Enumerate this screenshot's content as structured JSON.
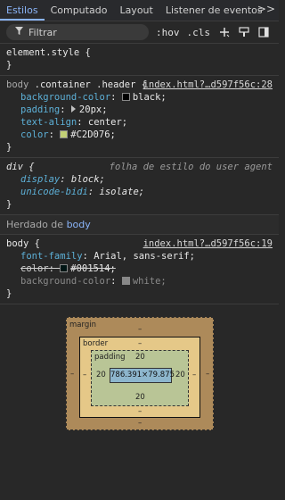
{
  "tabs": [
    "Estilos",
    "Computado",
    "Layout",
    "Listener de eventos"
  ],
  "more_icon": ">>",
  "toolbar": {
    "filter_placeholder": "Filtrar",
    "hov": ":hov",
    "cls": ".cls",
    "add_icon": "+",
    "icon_paint": "paint-icon",
    "icon_sidebar": "sidebar-toggle-icon"
  },
  "element_style": {
    "selector": "element.style {",
    "close": "}"
  },
  "rule1": {
    "selector_prefix": "body",
    "selector_main": " .container .header {",
    "source": "index.html?…d597f56c:28",
    "decls": [
      {
        "name": "background-color",
        "value": "black;",
        "swatch": "#000000"
      },
      {
        "name": "padding",
        "value": "20px;",
        "expand": true
      },
      {
        "name": "text-align",
        "value": "center;"
      },
      {
        "name": "color",
        "value": "#C2D076;",
        "swatch": "#C2D076"
      }
    ],
    "close": "}"
  },
  "rule2": {
    "selector": "div {",
    "source": "folha de estilo do user agent",
    "decls": [
      {
        "name": "display",
        "value": "block;"
      },
      {
        "name": "unicode-bidi",
        "value": "isolate;"
      }
    ],
    "close": "}"
  },
  "inherited": {
    "text": "Herdado de",
    "tag": "body"
  },
  "rule3": {
    "selector": "body {",
    "source": "index.html?…d597f56c:19",
    "decls": [
      {
        "name": "font-family",
        "value": "Arial, sans-serif;"
      },
      {
        "name": "color",
        "value": "#001514;",
        "swatch": "#001514"
      },
      {
        "name": "background-color",
        "value": "white;",
        "swatch": "#888888"
      }
    ],
    "close": "}"
  },
  "box_model": {
    "margin_label": "margin",
    "margin_top": "–",
    "margin_bottom": "–",
    "margin_left": "–",
    "margin_right": "–",
    "border_label": "border",
    "border_top": "–",
    "border_bottom": "–",
    "border_left": "–",
    "border_right": "–",
    "padding_label": "padding",
    "padding_top": "20",
    "padding_bottom": "20",
    "padding_left": "20",
    "padding_right": "20",
    "content": "786.391×79.875"
  }
}
